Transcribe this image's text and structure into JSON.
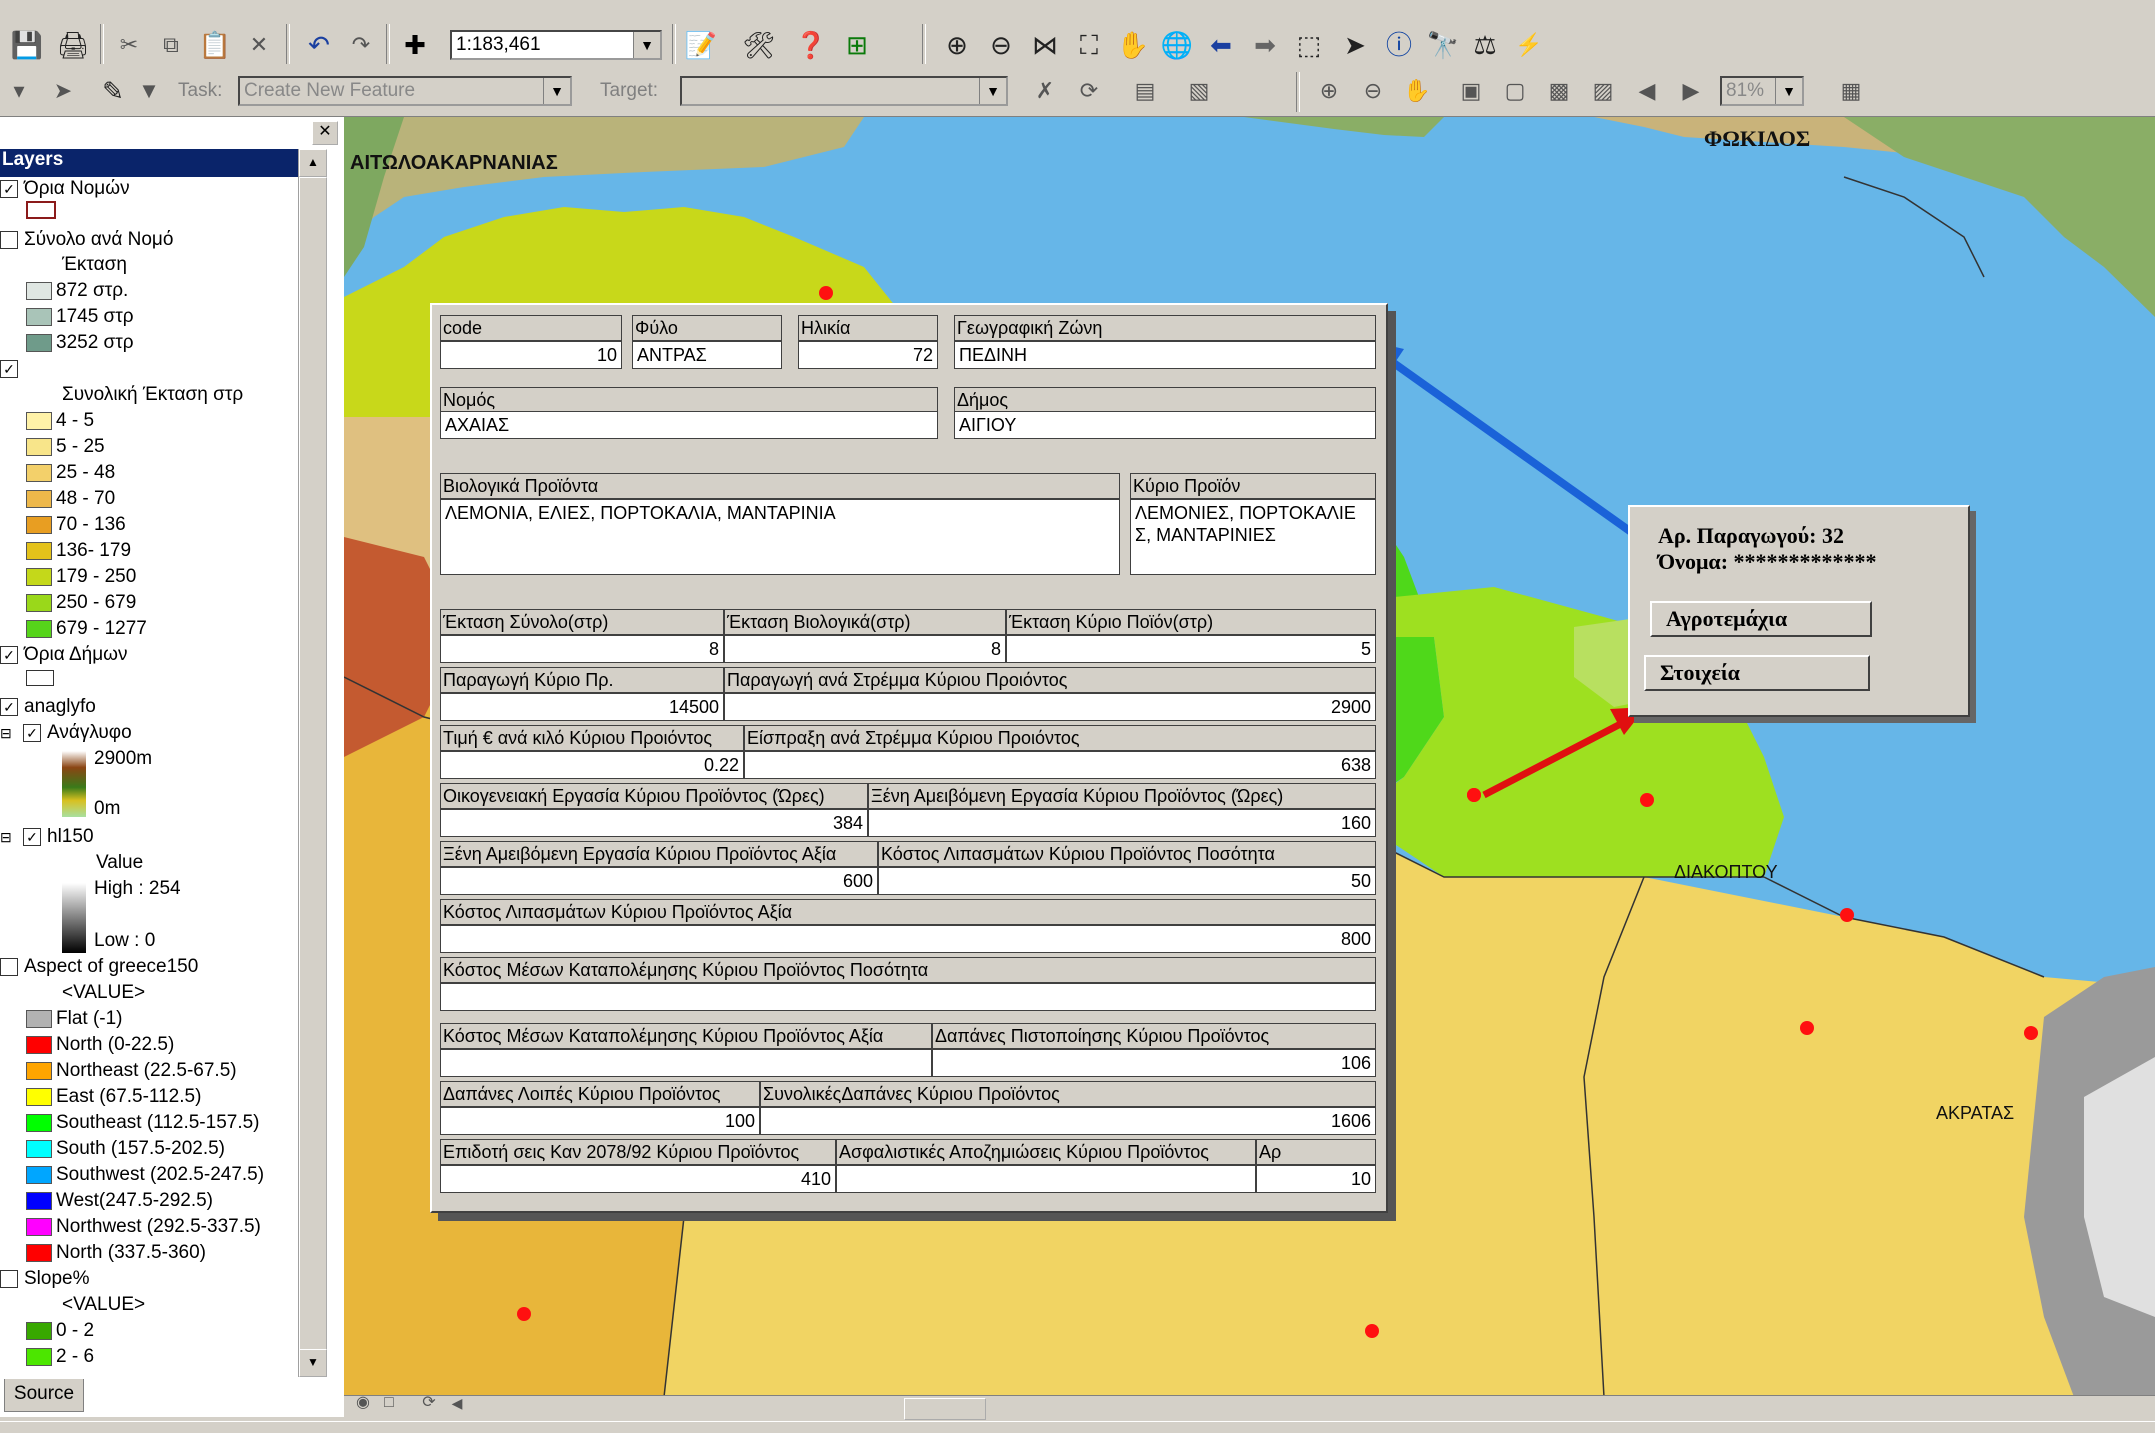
{
  "toolbar": {
    "scale_value": "1:183,461",
    "task_label": "Task:",
    "task_value": "Create New Feature",
    "target_label": "Target:",
    "target_value": "",
    "zoom_percent": "81%"
  },
  "toc": {
    "title": "Layers",
    "source_tab": "Source",
    "rows": [
      "Όρια Νομών",
      "Σύνολο ανά Νομό",
      "Έκταση",
      "872 στρ.",
      "1745 στρ",
      "3252 στρ",
      "Συνολική Έκταση στρ",
      "4 - 5",
      "5 - 25",
      "25 - 48",
      "48 - 70",
      "70 - 136",
      "136- 179",
      "179 - 250",
      "250 - 679",
      "679 - 1277",
      "Όρια Δήμων",
      "anaglyfo",
      "Ανάγλυφο",
      "2900m",
      "0m",
      "hl150",
      "Value",
      "High : 254",
      "Low : 0",
      "Aspect of greece150",
      "<VALUE>",
      "Flat (-1)",
      "North (0-22.5)",
      "Northeast (22.5-67.5)",
      "East (67.5-112.5)",
      "Southeast (112.5-157.5)",
      "South (157.5-202.5)",
      "Southwest (202.5-247.5)",
      "West(247.5-292.5)",
      "Northwest (292.5-337.5)",
      "North (337.5-360)",
      "Slope%",
      "<VALUE>",
      "0 - 2",
      "2 - 6"
    ],
    "colors": {
      "ekt_872": "#dfe6e2",
      "ekt_1745": "#a9c4b8",
      "ekt_3252": "#6f9b8a",
      "c_4_5": "#fff2a8",
      "c_5_25": "#f8e58a",
      "c_25_48": "#f3d06a",
      "c_48_70": "#eeb84a",
      "c_70_136": "#e89e22",
      "c_136_179": "#e4c21a",
      "c_179_250": "#c4d81a",
      "c_250_679": "#9ad81a",
      "c_679_1277": "#56d41a",
      "flat": "#b2b2b2",
      "north": "#ff0000",
      "northeast": "#ffa500",
      "east": "#ffff00",
      "southeast": "#00ff00",
      "south": "#00ffff",
      "southwest": "#00a6ff",
      "west": "#0000ff",
      "northwest": "#ff00ff",
      "north2": "#ff0000",
      "slope_0_2": "#38a800",
      "slope_2_6": "#4ce600"
    }
  },
  "map": {
    "labels": {
      "aitoloakarnania": "ΑΙΤΩΛΟΑΚΑΡΝΑΝΙΑΣ",
      "fokidos": "ΦΩΚΙΔΟΣ",
      "diakoptou": "ΔΙΑΚΟΠΤΟΥ",
      "akratas": "ΑΚΡΑΤΑΣ"
    }
  },
  "form": {
    "code_label": "code",
    "code_value": "10",
    "fylo_label": "Φύλο",
    "fylo_value": "ΑΝΤΡΑΣ",
    "ilikia_label": "Ηλικία",
    "ilikia_value": "72",
    "zoni_label": "Γεωγραφική Ζώνη",
    "zoni_value": "ΠΕΔΙΝΗ",
    "nomos_label": "Νομός",
    "nomos_value": "ΑΧΑΙΑΣ",
    "dimos_label": "Δήμος",
    "dimos_value": "ΑΙΓΙΟΥ",
    "bio_label": "Βιολογικά Προϊόντα",
    "bio_value": "ΛΕΜΟΝΙΑ, ΕΛΙΕΣ, ΠΟΡΤΟΚΑΛΙΑ, ΜΑΝΤΑΡΙΝΙΑ",
    "kyrio_label": "Κύριο Προϊόν",
    "kyrio_value": "ΛΕΜΟΝΙΕΣ, ΠΟΡΤΟΚΑΛΙΕ Σ, ΜΑΝΤΑΡΙΝΙΕΣ",
    "ekt_synolo_label": "Έκταση Σύνολο(στρ)",
    "ekt_synolo_value": "8",
    "ekt_bio_label": "Έκταση Βιολογικά(στρ)",
    "ekt_bio_value": "8",
    "ekt_kyrio_label": "Έκταση Κύριο Ποϊόν(στρ)",
    "ekt_kyrio_value": "5",
    "paragogi_label": "Παραγωγή Κύριο Πρ.",
    "paragogi_value": "14500",
    "paragogi_strema_label": "Παραγωγή ανά Στρέμμα Κύριου Προιόντος",
    "paragogi_strema_value": "2900",
    "timi_label": "Τιμή € ανά κιλό Κύριου Προιόντος",
    "timi_value": "0.22",
    "eispraxi_label": "Είσπραξη ανά Στρέμμα Κύριου Προιόντος",
    "eispraxi_value": "638",
    "oikog_label": "Οικογενειακή Εργασία Κύριου Προϊόντος (Ώρες)",
    "oikog_value": "384",
    "xeni_ores_label": "Ξένη Αμειβόμενη Εργασία Κύριου Προϊόντος (Ώρες)",
    "xeni_ores_value": "160",
    "xeni_axia_label": "Ξένη Αμειβόμενη Εργασία Κύριου Προϊόντος Αξία",
    "xeni_axia_value": "600",
    "lipasm_pos_label": "Κόστος Λιπασμάτων Κύριου Προϊόντος Ποσότητα",
    "lipasm_pos_value": "50",
    "lipasm_axia_label": "Κόστος Λιπασμάτων Κύριου Προϊόντος Αξία",
    "lipasm_axia_value": "800",
    "fyto_pos_label": "Κόστος Μέσων Καταπολέμησης Κύριου Προϊόντος Ποσότητα",
    "fyto_pos_value": "",
    "fyto_axia_label": "Κόστος Μέσων Καταπολέμησης Κύριου Προϊόντος Αξία",
    "fyto_axia_value": "",
    "pistop_label": "Δαπάνες Πιστοποίησης Κύριου Προϊόντος",
    "pistop_value": "106",
    "loipes_label": "Δαπάνες Λοιπές Κύριου Προϊόντος",
    "loipes_value": "100",
    "synolikes_label": "ΣυνολικέςΔαπάνες Κύριου Προϊόντος",
    "synolikes_value": "1606",
    "epidotisi_label": "Επιδοτή σεις Καν 2078/92 Κύριου Προϊόντος",
    "epidotisi_value": "410",
    "asfal_label": "Ασφαλιστικές Αποζημιώσεις Κύριου Προϊόντος",
    "asfal_value": "",
    "ar_label": "Αρ",
    "ar_value": "10"
  },
  "popup": {
    "producer_line": "Αρ. Παραγωγού: 32",
    "name_line": "Όνομα: *************",
    "agrotemaxia_button": "Αγροτεμάχια",
    "stoixeia_button": "Στοιχεία"
  }
}
